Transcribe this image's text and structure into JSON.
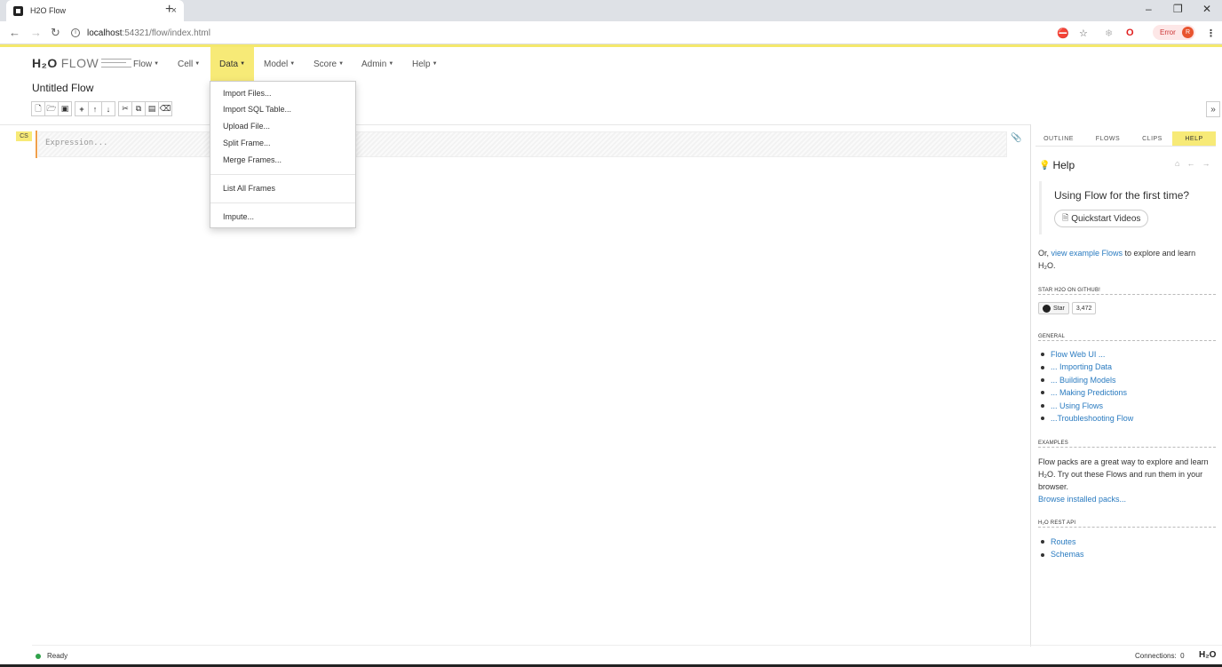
{
  "browser": {
    "tab_title": "H2O Flow",
    "tab_close": "×",
    "new_tab": "+",
    "win_min": "–",
    "win_max": "❐",
    "win_close": "✕",
    "url_host": "localhost",
    "url_path": ":54321/flow/index.html",
    "error_label": "Error",
    "avatar_letter": "R"
  },
  "logo": {
    "h2o": "H₂O",
    "flow": "FLOW"
  },
  "menubar": {
    "items": [
      {
        "label": "Flow"
      },
      {
        "label": "Cell"
      },
      {
        "label": "Data"
      },
      {
        "label": "Model"
      },
      {
        "label": "Score"
      },
      {
        "label": "Admin"
      },
      {
        "label": "Help"
      }
    ],
    "active": "Data"
  },
  "flow_title": "Untitled Flow",
  "cell": {
    "tag": "CS",
    "placeholder": "Expression..."
  },
  "data_menu": {
    "items": [
      "Import Files...",
      "Import SQL Table...",
      "Upload File...",
      "Split Frame...",
      "Merge Frames...",
      "List All Frames",
      "Impute..."
    ]
  },
  "right_panel": {
    "tabs": [
      "OUTLINE",
      "FLOWS",
      "CLIPS",
      "HELP"
    ],
    "active_tab": "HELP",
    "help_title": "Help",
    "first_time": "Using Flow for the first time?",
    "quickstart": "Quickstart Videos",
    "or_text": "Or, ",
    "example_link": "view example Flows",
    "explore_text": " to explore and learn H₂O.",
    "github_header": "STAR H2O ON GITHUB!",
    "star_label": "Star",
    "star_count": "3,472",
    "general_header": "GENERAL",
    "general_links": [
      "Flow Web UI ...",
      "... Importing Data",
      "... Building Models",
      "... Making Predictions",
      "... Using Flows",
      "...Troubleshooting Flow"
    ],
    "examples_header": "EXAMPLES",
    "examples_text": "Flow packs are a great way to explore and learn H₂O. Try out these Flows and run them in your browser.",
    "browse_link": "Browse installed packs...",
    "rest_header": "H₂O REST API",
    "rest_links": [
      "Routes",
      "Schemas"
    ]
  },
  "status": {
    "text": "Ready",
    "connections_label": "Connections:",
    "connections_value": "0",
    "brand": "H₂O"
  }
}
